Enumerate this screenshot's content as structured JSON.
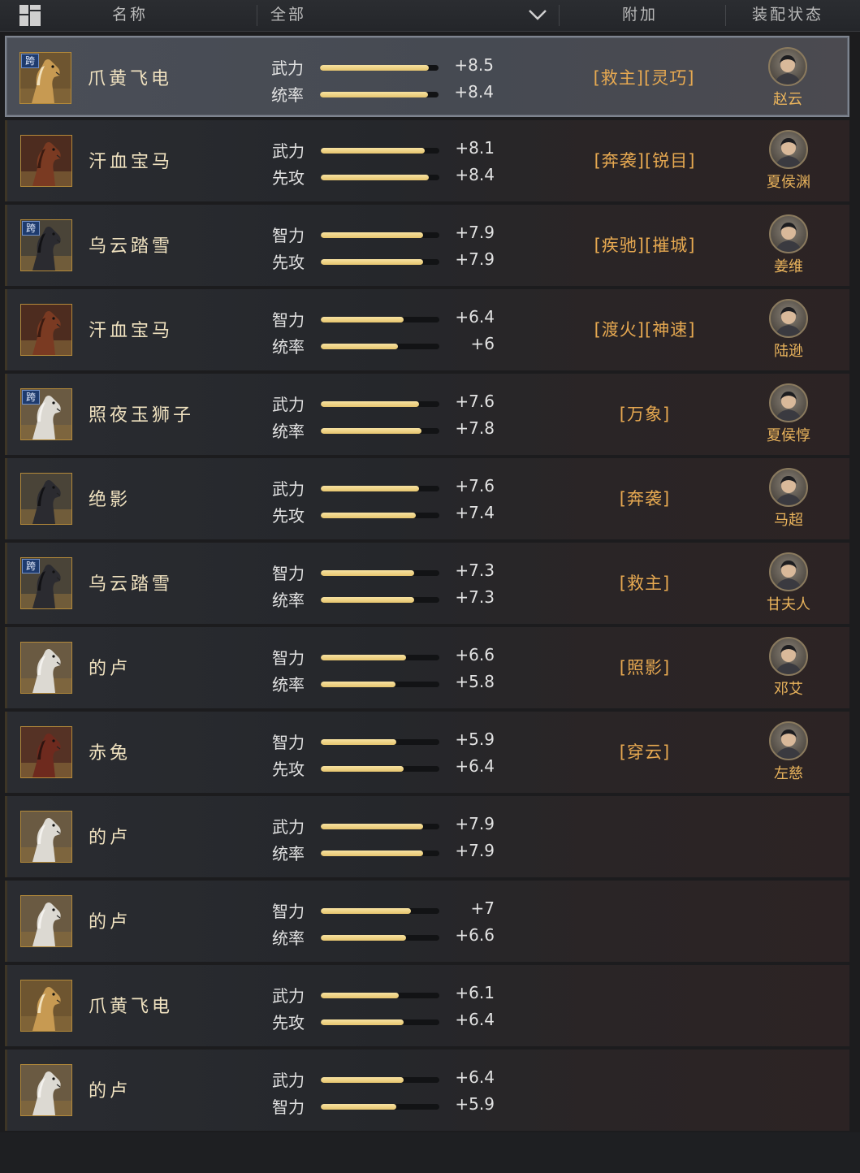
{
  "header": {
    "name_label": "名称",
    "filter_label": "全部",
    "extra_label": "附加",
    "status_label": "装配状态"
  },
  "colors": {
    "accent_gold": "#e6c56e",
    "extra_text": "#e7a951",
    "general_name": "#eab45c"
  },
  "horses": [
    {
      "name": "爪黄飞电",
      "kua": "跨",
      "coat": "palomino",
      "selected": true,
      "stats": [
        {
          "label": "武力",
          "value": "+8.5",
          "level": 0.92
        },
        {
          "label": "统率",
          "value": "+8.4",
          "level": 0.91
        }
      ],
      "extra": "[救主][灵巧]",
      "general": "赵云"
    },
    {
      "name": "汗血宝马",
      "kua": "",
      "coat": "chestnut",
      "selected": false,
      "stats": [
        {
          "label": "武力",
          "value": "+8.1",
          "level": 0.88
        },
        {
          "label": "先攻",
          "value": "+8.4",
          "level": 0.91
        }
      ],
      "extra": "[奔袭][锐目]",
      "general": "夏侯渊"
    },
    {
      "name": "乌云踏雪",
      "kua": "跨",
      "coat": "black",
      "selected": false,
      "stats": [
        {
          "label": "智力",
          "value": "+7.9",
          "level": 0.86
        },
        {
          "label": "先攻",
          "value": "+7.9",
          "level": 0.86
        }
      ],
      "extra": "[疾驰][摧城]",
      "general": "姜维"
    },
    {
      "name": "汗血宝马",
      "kua": "",
      "coat": "chestnut",
      "selected": false,
      "stats": [
        {
          "label": "智力",
          "value": "+6.4",
          "level": 0.7
        },
        {
          "label": "统率",
          "value": "+6",
          "level": 0.65
        }
      ],
      "extra": "[渡火][神速]",
      "general": "陆逊"
    },
    {
      "name": "照夜玉狮子",
      "kua": "跨",
      "coat": "white",
      "selected": false,
      "stats": [
        {
          "label": "武力",
          "value": "+7.6",
          "level": 0.83
        },
        {
          "label": "统率",
          "value": "+7.8",
          "level": 0.85
        }
      ],
      "extra": "[万象]",
      "general": "夏侯惇"
    },
    {
      "name": "绝影",
      "kua": "",
      "coat": "black",
      "selected": false,
      "stats": [
        {
          "label": "武力",
          "value": "+7.6",
          "level": 0.83
        },
        {
          "label": "先攻",
          "value": "+7.4",
          "level": 0.8
        }
      ],
      "extra": "[奔袭]",
      "general": "马超"
    },
    {
      "name": "乌云踏雪",
      "kua": "跨",
      "coat": "black",
      "selected": false,
      "stats": [
        {
          "label": "智力",
          "value": "+7.3",
          "level": 0.79
        },
        {
          "label": "统率",
          "value": "+7.3",
          "level": 0.79
        }
      ],
      "extra": "[救主]",
      "general": "甘夫人"
    },
    {
      "name": "的卢",
      "kua": "",
      "coat": "white",
      "selected": false,
      "stats": [
        {
          "label": "智力",
          "value": "+6.6",
          "level": 0.72
        },
        {
          "label": "统率",
          "value": "+5.8",
          "level": 0.63
        }
      ],
      "extra": "[照影]",
      "general": "邓艾"
    },
    {
      "name": "赤兔",
      "kua": "",
      "coat": "red",
      "selected": false,
      "stats": [
        {
          "label": "智力",
          "value": "+5.9",
          "level": 0.64
        },
        {
          "label": "先攻",
          "value": "+6.4",
          "level": 0.7
        }
      ],
      "extra": "[穿云]",
      "general": "左慈"
    },
    {
      "name": "的卢",
      "kua": "",
      "coat": "white",
      "selected": false,
      "stats": [
        {
          "label": "武力",
          "value": "+7.9",
          "level": 0.86
        },
        {
          "label": "统率",
          "value": "+7.9",
          "level": 0.86
        }
      ],
      "extra": "",
      "general": ""
    },
    {
      "name": "的卢",
      "kua": "",
      "coat": "white",
      "selected": false,
      "stats": [
        {
          "label": "智力",
          "value": "+7",
          "level": 0.76
        },
        {
          "label": "统率",
          "value": "+6.6",
          "level": 0.72
        }
      ],
      "extra": "",
      "general": ""
    },
    {
      "name": "爪黄飞电",
      "kua": "",
      "coat": "palomino",
      "selected": false,
      "stats": [
        {
          "label": "武力",
          "value": "+6.1",
          "level": 0.66
        },
        {
          "label": "先攻",
          "value": "+6.4",
          "level": 0.7
        }
      ],
      "extra": "",
      "general": ""
    },
    {
      "name": "的卢",
      "kua": "",
      "coat": "white",
      "selected": false,
      "stats": [
        {
          "label": "武力",
          "value": "+6.4",
          "level": 0.7
        },
        {
          "label": "智力",
          "value": "+5.9",
          "level": 0.64
        }
      ],
      "extra": "",
      "general": ""
    }
  ]
}
